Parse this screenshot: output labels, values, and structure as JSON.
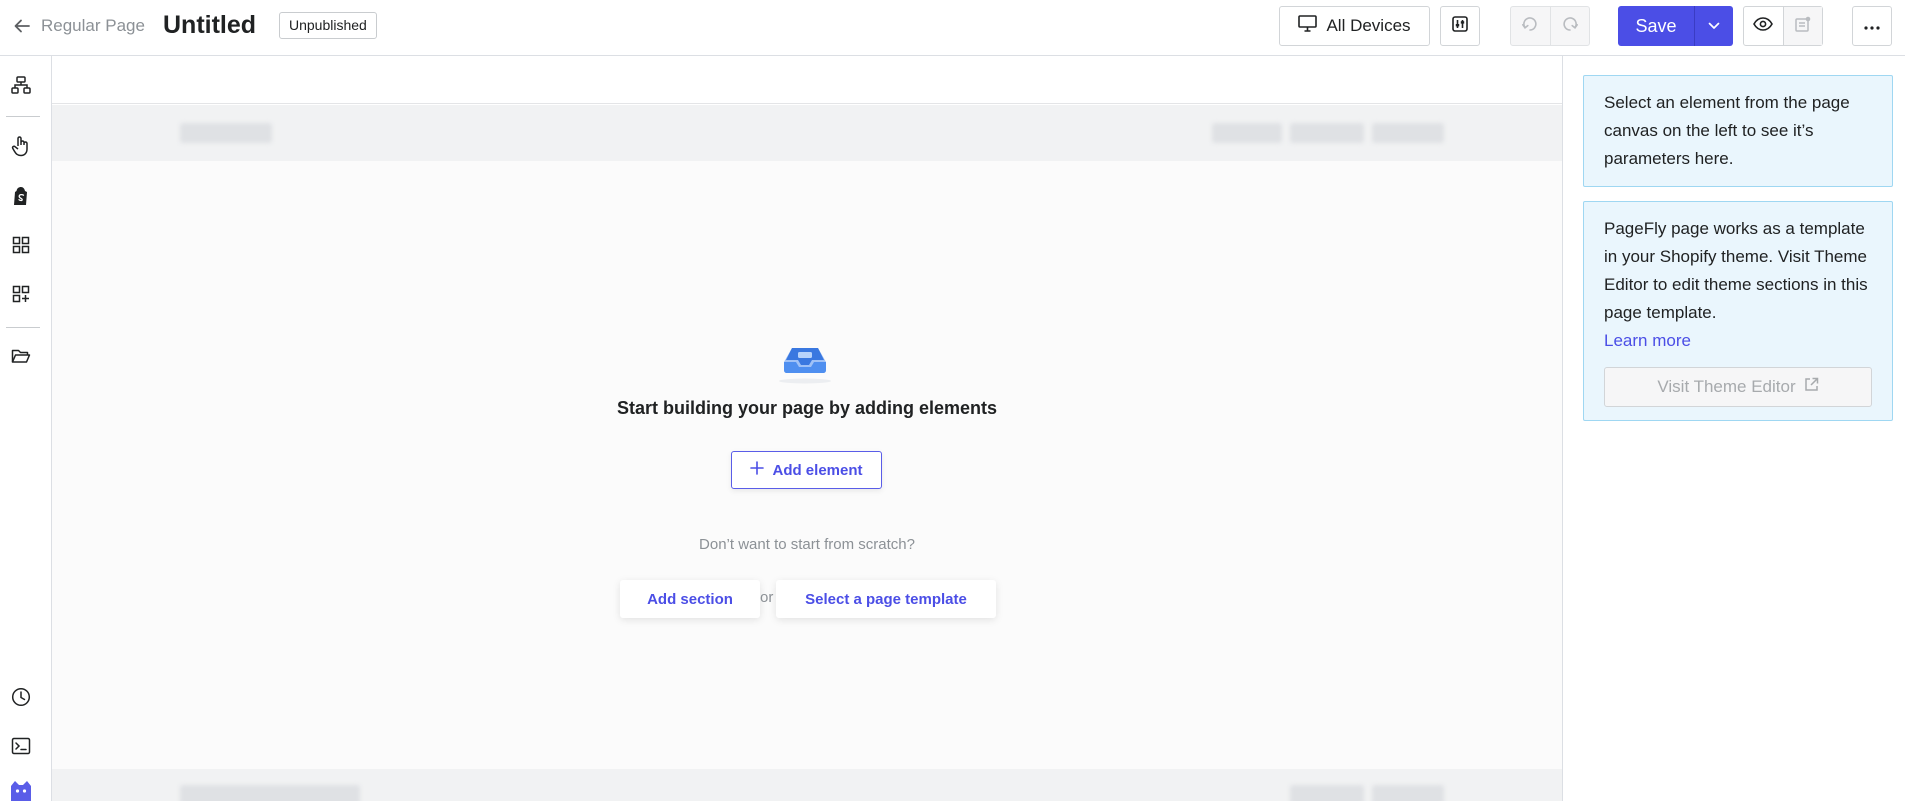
{
  "topbar": {
    "breadcrumb": "Regular Page",
    "title": "Untitled",
    "status_badge": "Unpublished",
    "devices_label": "All Devices",
    "save_label": "Save",
    "accent_color": "#4b4ee6"
  },
  "sidebar": {
    "items": [
      {
        "icon": "layers-tree-icon"
      },
      {
        "icon": "hand-pointer-icon"
      },
      {
        "icon": "shopify-bag-icon"
      },
      {
        "icon": "grid-icon"
      },
      {
        "icon": "grid-plus-icon"
      },
      {
        "icon": "folder-open-icon"
      },
      {
        "icon": "history-clock-icon"
      },
      {
        "icon": "terminal-icon"
      }
    ]
  },
  "canvas": {
    "empty_title": "Start building your page by adding elements",
    "add_element_label": "Add element",
    "subtitle": "Don’t want to start from scratch?",
    "add_section_label": "Add section",
    "or_label": "or",
    "select_template_label": "Select a page template"
  },
  "panel": {
    "hint_text": "Select an element from the page canvas on the left to see it’s parameters here.",
    "theme_info_text": "PageFly page works as a template in your Shopify theme. Visit Theme Editor to edit theme sections in this page template.",
    "learn_more_label": "Learn more",
    "visit_theme_editor_label": "Visit Theme Editor"
  }
}
